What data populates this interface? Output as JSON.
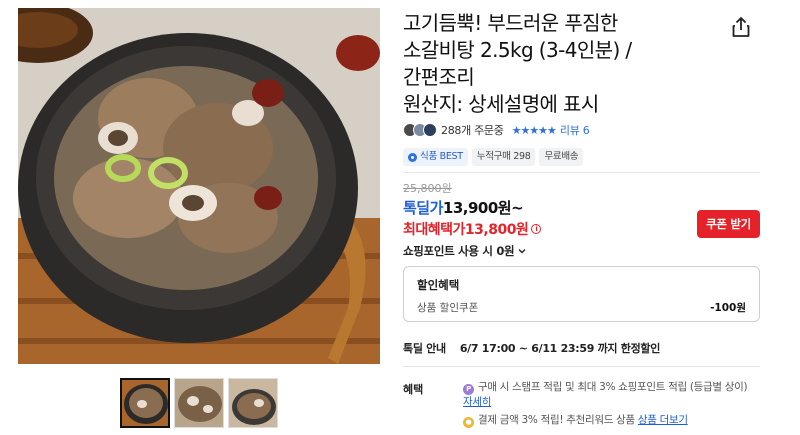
{
  "product": {
    "title_line1": "고기듬뿍! 부드러운 푸짐한",
    "title_line2": "소갈비탕 2.5kg (3-4인분) /",
    "title_line3": "간편조리",
    "title_line4": "원산지: 상세설명에 표시"
  },
  "review": {
    "order_count": "288개 주문중",
    "stars": "★★★★★",
    "review_link": "리뷰 6"
  },
  "tags": {
    "best": "식품 BEST",
    "cumulative": "누적구매 298",
    "shipping": "무료배송"
  },
  "price": {
    "original": "25,800원",
    "tokdeal_label": "톡딜가",
    "tokdeal_value": "13,900원~",
    "max_label": "최대혜택가",
    "max_value": "13,800원",
    "coupon_button": "쿠폰 받기",
    "points_text": "쇼핑포인트 사용 시 0원"
  },
  "discount": {
    "header": "할인혜택",
    "row_label": "상품 할인쿠폰",
    "row_value": "-100원"
  },
  "tokdeal_info": {
    "label": "톡딜 안내",
    "period": "6/7 17:00 ~ 6/11 23:59 까지 한정할인"
  },
  "benefits": {
    "label": "혜택",
    "line1": "구매 시 스탬프 적립 및 최대 3% 쇼핑포인트 적립 (등급별 상이)",
    "line1_link": "자세히",
    "line2": "결제 금액 3% 적립! 추천리워드 상품",
    "line2_link": "상품 더보기"
  },
  "colors": {
    "accent_blue": "#1f5fd6",
    "accent_red": "#e3242b"
  },
  "icons": {
    "share": "share-icon",
    "chevron": "chevron-down-icon",
    "info": "info-icon"
  }
}
